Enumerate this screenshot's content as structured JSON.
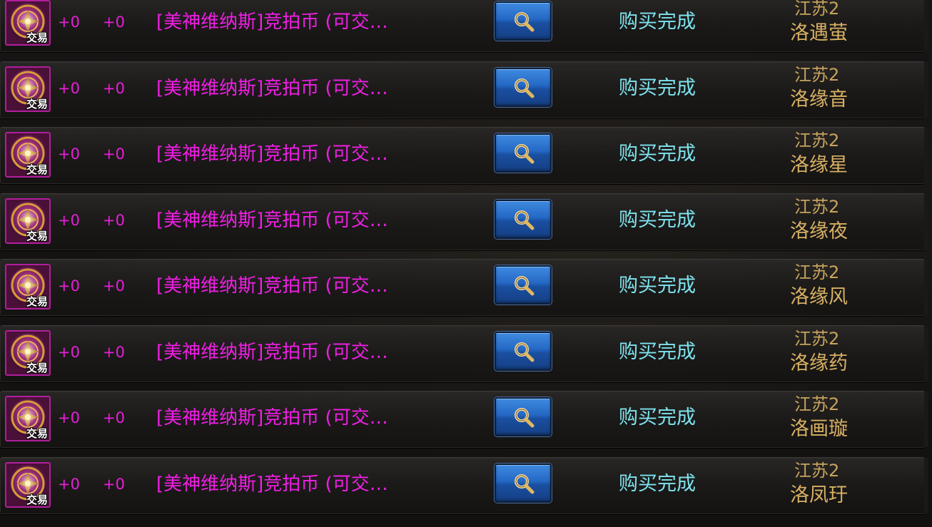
{
  "colors": {
    "item_name": "#f01ee4",
    "plus_values": "#e81ed8",
    "status": "#7ee3ee",
    "server": "#c7a35d",
    "seller": "#d8b064",
    "search_button": "#2468c4"
  },
  "rows": [
    {
      "trade_tag": "交易",
      "plus_a": "+0",
      "plus_b": "+0",
      "item_name": "[美神维纳斯]竞拍币 (可交…",
      "status": "购买完成",
      "server": "江苏2",
      "seller": "洛遇萤",
      "search_icon": "magnifier-icon"
    },
    {
      "trade_tag": "交易",
      "plus_a": "+0",
      "plus_b": "+0",
      "item_name": "[美神维纳斯]竞拍币 (可交…",
      "status": "购买完成",
      "server": "江苏2",
      "seller": "洛缘音",
      "search_icon": "magnifier-icon"
    },
    {
      "trade_tag": "交易",
      "plus_a": "+0",
      "plus_b": "+0",
      "item_name": "[美神维纳斯]竞拍币 (可交…",
      "status": "购买完成",
      "server": "江苏2",
      "seller": "洛缘星",
      "search_icon": "magnifier-icon"
    },
    {
      "trade_tag": "交易",
      "plus_a": "+0",
      "plus_b": "+0",
      "item_name": "[美神维纳斯]竞拍币 (可交…",
      "status": "购买完成",
      "server": "江苏2",
      "seller": "洛缘夜",
      "search_icon": "magnifier-icon"
    },
    {
      "trade_tag": "交易",
      "plus_a": "+0",
      "plus_b": "+0",
      "item_name": "[美神维纳斯]竞拍币 (可交…",
      "status": "购买完成",
      "server": "江苏2",
      "seller": "洛缘风",
      "search_icon": "magnifier-icon"
    },
    {
      "trade_tag": "交易",
      "plus_a": "+0",
      "plus_b": "+0",
      "item_name": "[美神维纳斯]竞拍币 (可交…",
      "status": "购买完成",
      "server": "江苏2",
      "seller": "洛缘药",
      "search_icon": "magnifier-icon"
    },
    {
      "trade_tag": "交易",
      "plus_a": "+0",
      "plus_b": "+0",
      "item_name": "[美神维纳斯]竞拍币 (可交…",
      "status": "购买完成",
      "server": "江苏2",
      "seller": "洛画璇",
      "search_icon": "magnifier-icon"
    },
    {
      "trade_tag": "交易",
      "plus_a": "+0",
      "plus_b": "+0",
      "item_name": "[美神维纳斯]竞拍币 (可交…",
      "status": "购买完成",
      "server": "江苏2",
      "seller": "洛凤玗",
      "search_icon": "magnifier-icon"
    }
  ]
}
